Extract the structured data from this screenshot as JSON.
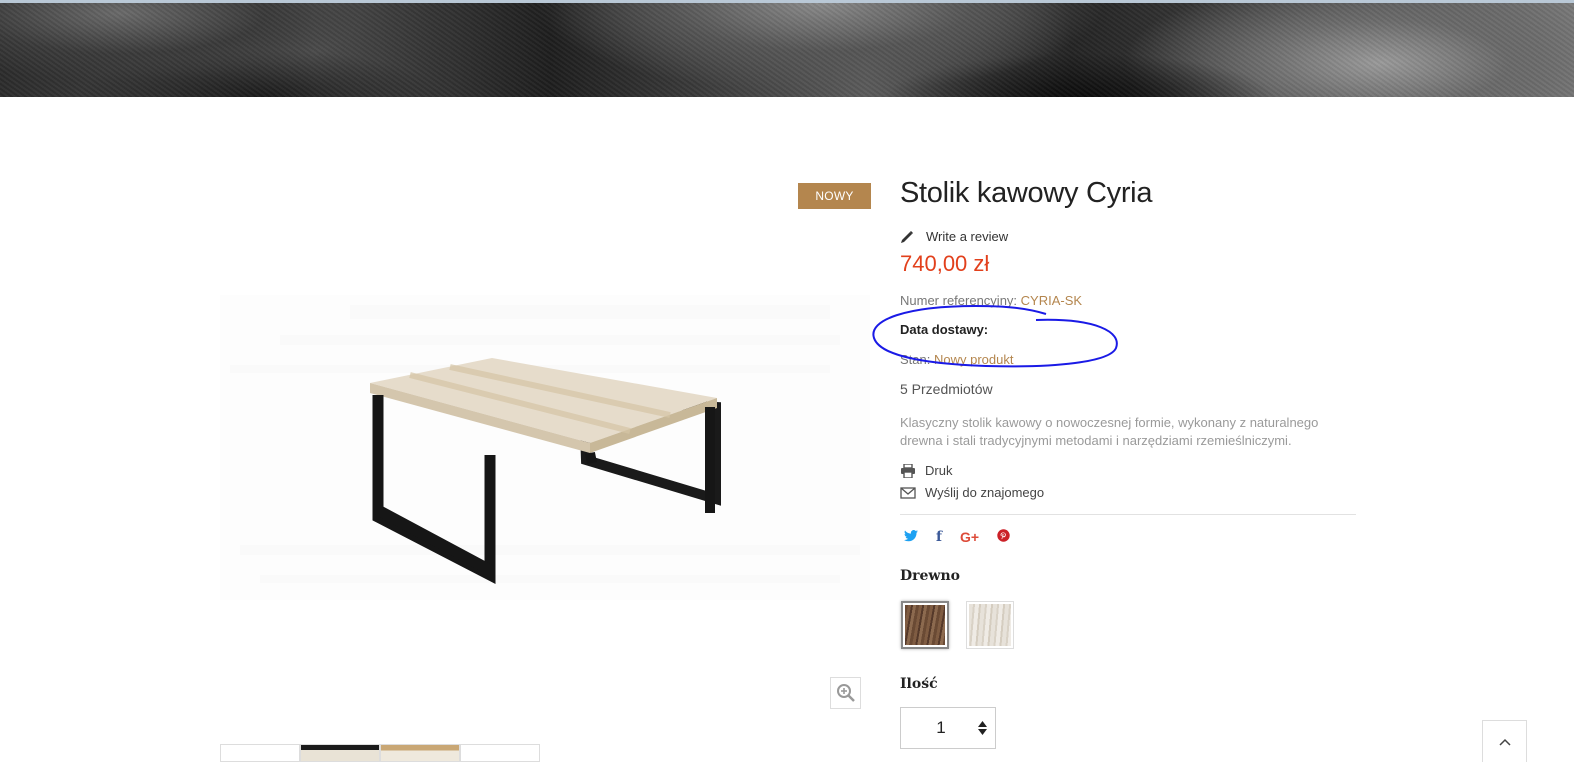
{
  "product": {
    "badge": "NOWY",
    "title": "Stolik kawowy Cyria",
    "review_label": "Write a review",
    "price": "740,00 zł",
    "reference_label": "Numer referencyjny:",
    "reference_value": "CYRIA-SK",
    "delivery_label": "Data dostawy:",
    "condition_label": "Stan:",
    "condition_value": "Nowy produkt",
    "stock": "5 Przedmiotów",
    "description": "Klasyczny stolik kawowy o nowoczesnej formie, wykonany z naturalnego drewna i stali tradycyjnymi metodami i narzędziami rzemieślniczymi."
  },
  "actions": {
    "print_label": "Druk",
    "send_label": "Wyślij do znajomego"
  },
  "social": {
    "twitter": "🐦",
    "facebook": "f",
    "google_plus": "G+",
    "pinterest": "P"
  },
  "attributes": {
    "wood_label": "Drewno",
    "quantity_label": "Ilość",
    "quantity_value": "1"
  },
  "colors": {
    "accent": "#b4864e",
    "price": "#e2401c",
    "annotation": "#1a1ae6"
  },
  "icons": [
    "pencil-icon",
    "print-icon",
    "envelope-icon",
    "zoom-in-icon",
    "chevron-up-icon"
  ]
}
